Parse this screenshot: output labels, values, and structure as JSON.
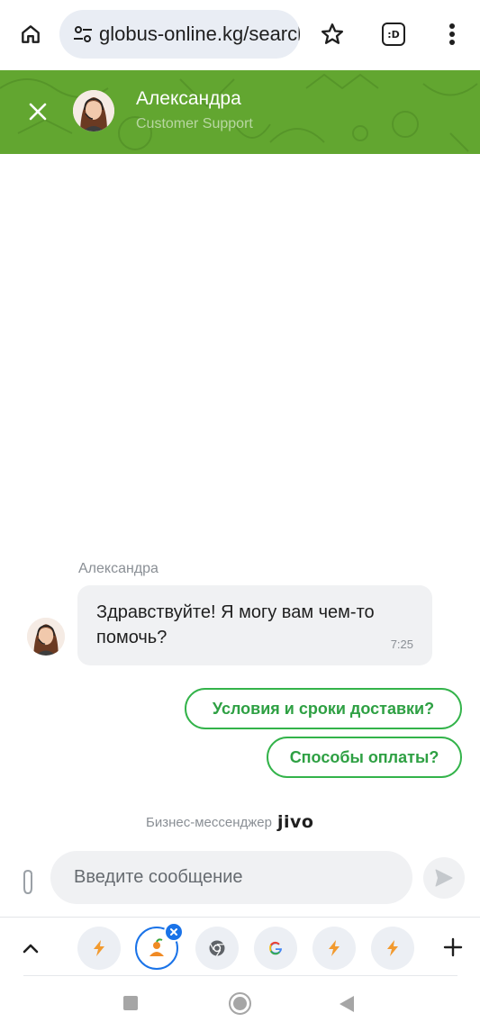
{
  "browser": {
    "url": "globus-online.kg/search",
    "tabs_count_label": ":D"
  },
  "chat": {
    "agent_name": "Александра",
    "agent_role": "Customer Support",
    "messages": [
      {
        "sender": "Александра",
        "text": "Здравствуйте! Я могу вам чем-то помочь?",
        "time": "7:25"
      }
    ],
    "quick_replies": [
      "Условия и сроки доставки?",
      "Способы оплаты?"
    ],
    "branding_text": "Бизнес-мессенджер",
    "branding_logo": "jivo",
    "input_placeholder": "Введите сообщение"
  },
  "tab_strip": {
    "tabs": [
      {
        "icon": "bolt-icon",
        "active": false
      },
      {
        "icon": "carrot-person-icon",
        "active": true
      },
      {
        "icon": "chrome-icon",
        "active": false
      },
      {
        "icon": "google-icon",
        "active": false
      },
      {
        "icon": "bolt-icon",
        "active": false
      },
      {
        "icon": "bolt-icon",
        "active": false
      }
    ]
  },
  "colors": {
    "header_green": "#62a630",
    "quick_reply_green": "#33b34a",
    "active_tab_blue": "#1a73e8"
  }
}
